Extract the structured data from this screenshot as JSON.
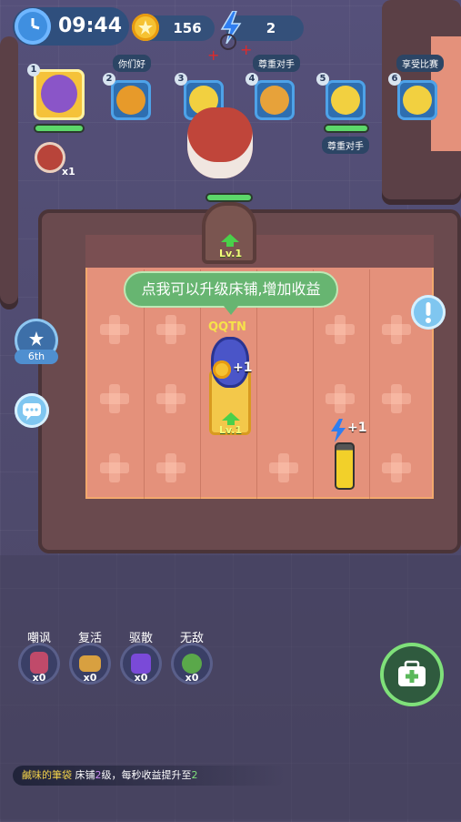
{
  "hud": {
    "time": "09:44",
    "coins": "156",
    "energy": "2"
  },
  "players": [
    {
      "rank": "1",
      "bubble": "",
      "color": "#8a55c8"
    },
    {
      "rank": "2",
      "bubble": "你们好",
      "color": "#e79a2a"
    },
    {
      "rank": "3",
      "bubble": "",
      "color": "#f2d040"
    },
    {
      "rank": "4",
      "bubble": "尊重对手",
      "color": "#e7a23a"
    },
    {
      "rank": "5",
      "bubble": "",
      "color": "#f2d040"
    },
    {
      "rank": "6",
      "bubble": "享受比赛",
      "color": "#f2d040"
    }
  ],
  "player5_label": "尊重对手",
  "hunter_count": "x1",
  "trophy_rank": "6th",
  "tip": "点我可以升级床铺,增加收益",
  "door_level": "Lv.1",
  "player_name": "QQTN",
  "bed_level": "Lv.1",
  "coin_gain": "+1",
  "energy_gain": "+1",
  "skills": [
    {
      "name": "嘲讽",
      "count": "x0",
      "color": "#c04a6a"
    },
    {
      "name": "复活",
      "count": "x0",
      "color": "#d8a040"
    },
    {
      "name": "驱散",
      "count": "x0",
      "color": "#7a4ad8"
    },
    {
      "name": "无敌",
      "count": "x0",
      "color": "#5aa84a"
    }
  ],
  "message": {
    "sender": "鹹味的筆袋",
    "text_a": "床铺",
    "level": "2",
    "text_b": "级，每秒收益提升至",
    "value": "2"
  },
  "colors": {
    "sender": "#f2d24a",
    "level": "#c98af0",
    "value": "#7fe07a"
  }
}
